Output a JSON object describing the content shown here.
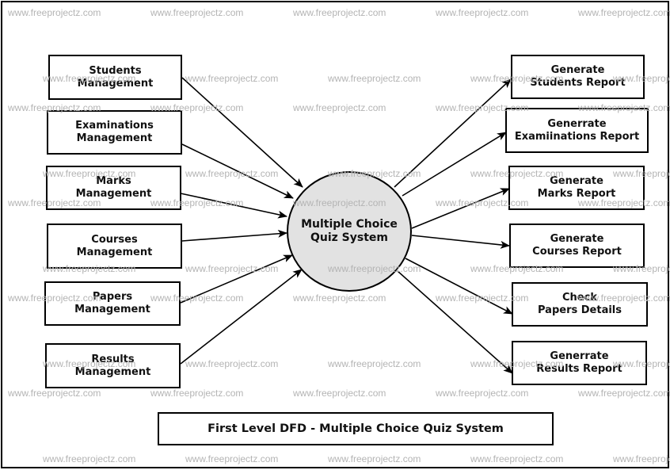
{
  "watermark": "www.freeprojectz.com",
  "central_process": {
    "line1": "Multiple Choice",
    "line2": "Quiz System"
  },
  "inputs": [
    {
      "line1": "Students",
      "line2": "Management"
    },
    {
      "line1": "Examinations",
      "line2": "Management"
    },
    {
      "line1": "Marks",
      "line2": "Management"
    },
    {
      "line1": "Courses",
      "line2": "Management"
    },
    {
      "line1": "Papers",
      "line2": "Management"
    },
    {
      "line1": "Results",
      "line2": "Management"
    }
  ],
  "outputs": [
    {
      "line1": "Generate",
      "line2": "Students Report"
    },
    {
      "line1": "Generrate",
      "line2": "Examiinations Report"
    },
    {
      "line1": "Generate",
      "line2": "Marks Report"
    },
    {
      "line1": "Generate",
      "line2": "Courses Report"
    },
    {
      "line1": "Check",
      "line2": "Papers Details"
    },
    {
      "line1": "Generrate",
      "line2": "Results Report"
    }
  ],
  "title": "First Level DFD - Multiple Choice Quiz System",
  "colors": {
    "process_fill": "#e2e2e2",
    "watermark": "#b4b4b4",
    "stroke": "#000000"
  }
}
